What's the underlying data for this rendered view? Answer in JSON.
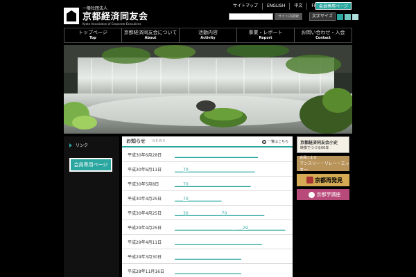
{
  "logo": {
    "sub": "一般社団法人",
    "main": "京都経済同友会",
    "en": "Kyoto Association of Corporate Executives"
  },
  "top_links": {
    "sitemap": "サイトマップ",
    "english": "ENGLISH",
    "chinese": "中文",
    "french": "FRANÇAISE",
    "member": "会員専用ページ"
  },
  "search": {
    "placeholder": "",
    "button": "サイト内検索"
  },
  "textsize": {
    "label": "文字サイズ",
    "colors": [
      "#2aa7a0",
      "#6fc7c1",
      "#aee0dc"
    ]
  },
  "nav": [
    {
      "jp": "トップページ",
      "en": "Top"
    },
    {
      "jp": "京都経済同友会について",
      "en": "About"
    },
    {
      "jp": "活動内容",
      "en": "Activity"
    },
    {
      "jp": "事業・レポート",
      "en": "Report"
    },
    {
      "jp": "お問い合わせ・入会",
      "en": "Contact"
    }
  ],
  "left": {
    "link_title": "リンク",
    "member_button": "会員専用ページ"
  },
  "news": {
    "title": "お知らせ",
    "sub": "NEWS",
    "more": "一覧はこちら",
    "items": [
      {
        "date": "平成30年6月28日",
        "text": "＿＿＿＿＿＿＿＿＿＿＿＿＿＿＿＿＿＿＿＿"
      },
      {
        "date": "平成30年6月11日",
        "text": "＿＿70＿＿＿＿＿＿＿＿＿＿＿＿＿＿＿＿"
      },
      {
        "date": "平成30年5月8日",
        "text": "＿＿70＿＿＿＿＿＿＿＿＿＿＿＿＿＿＿"
      },
      {
        "date": "平成30年4月25日",
        "text": "＿＿70＿＿＿＿＿＿＿＿"
      },
      {
        "date": "平成30年4月25日",
        "text": "＿＿30＿＿＿＿＿＿＿＿70＿＿＿＿＿＿＿＿＿"
      },
      {
        "date": "平成29年4月25日",
        "text": "＿＿＿＿＿＿＿＿＿＿＿＿＿＿ ＿＿29＿＿＿＿＿＿＿＿＿"
      },
      {
        "date": "平成29年4月11日",
        "text": "＿＿＿＿＿＿＿＿＿＿＿＿＿＿＿＿＿＿＿＿＿"
      },
      {
        "date": "平成29年3月30日",
        "text": "＿＿＿＿＿＿＿＿＿＿＿＿＿＿＿＿"
      },
      {
        "date": "平成28年11月16日",
        "text": "＿＿＿＿＿＿＿＿＿＿＿＿＿＿＿＿"
      }
    ]
  },
  "banners": {
    "history_l1": "京都経済同友会小史",
    "history_l2": "映像でつづる60年",
    "essay_l1": "会員による",
    "essay_l2": "マンスリー・リレー・エッセー",
    "rediscover": "京都再発見",
    "academic": "京都学講座"
  }
}
